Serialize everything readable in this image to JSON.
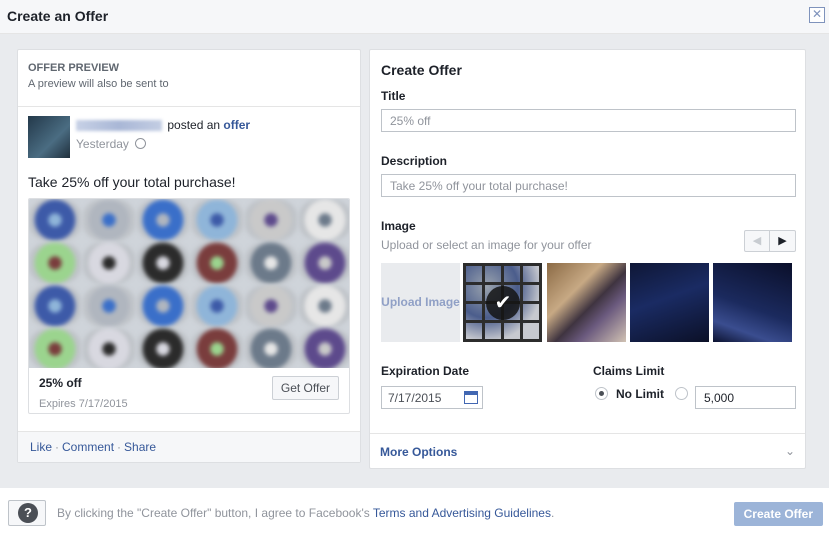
{
  "dialog": {
    "title": "Create an Offer",
    "close_icon": "close-icon"
  },
  "preview": {
    "heading": "OFFER PREVIEW",
    "subheading": "A preview will also be sent to",
    "posted_text": "posted an",
    "offer_link": "offer",
    "time": "Yesterday",
    "post_text": "Take 25% off your total purchase!",
    "card": {
      "title": "25% off",
      "expires": "Expires 7/17/2015",
      "button": "Get Offer"
    },
    "footer": {
      "like": "Like",
      "comment": "Comment",
      "share": "Share",
      "sep": "·"
    }
  },
  "form": {
    "heading": "Create Offer",
    "title_label": "Title",
    "title_value": "25% off",
    "description_label": "Description",
    "description_value": "Take 25% off your total purchase!",
    "image_label": "Image",
    "image_help": "Upload or select an image for your offer",
    "upload_label": "Upload Image",
    "expiration_label": "Expiration Date",
    "expiration_value": "7/17/2015",
    "claims_label": "Claims Limit",
    "no_limit_label": "No Limit",
    "claims_value": "5,000",
    "more_options": "More Options"
  },
  "footer": {
    "help": "?",
    "disclaimer_pre": "By clicking the \"Create Offer\" button, I agree to Facebook's",
    "terms_link": "Terms and Advertising Guidelines",
    "disclaimer_post": ".",
    "create_button": "Create Offer"
  },
  "colors": {
    "link": "#365899",
    "primary_disabled": "#9cb4d8"
  }
}
